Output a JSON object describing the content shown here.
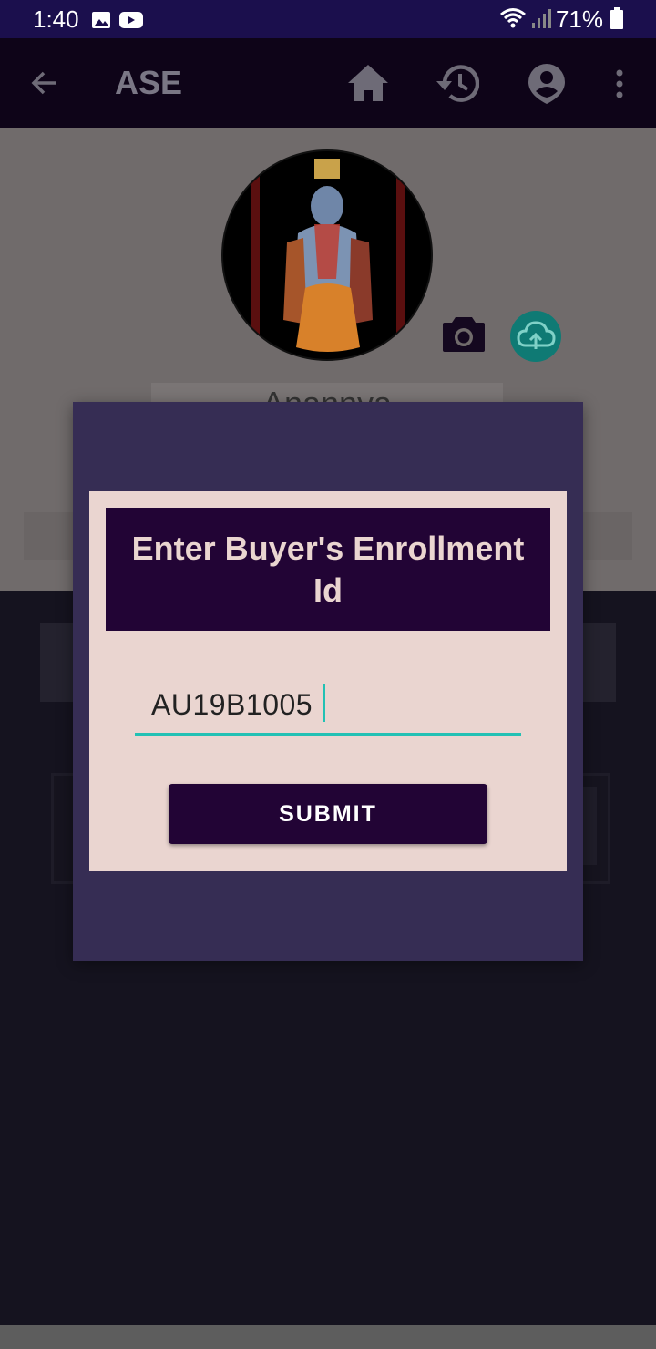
{
  "status_bar": {
    "time": "1:40",
    "battery": "71%",
    "icons": [
      "gallery-icon",
      "youtube-icon",
      "wifi-icon",
      "signal-icon",
      "battery-icon"
    ]
  },
  "app_bar": {
    "title": "ASE",
    "icons": [
      "back-arrow-icon",
      "home-icon",
      "history-icon",
      "account-icon",
      "more-vert-icon"
    ]
  },
  "profile": {
    "name": "Anannya"
  },
  "dialog": {
    "title": "Enter Buyer's Enrollment Id",
    "input_value": "AU19B1005",
    "submit_label": "SUBMIT"
  },
  "colors": {
    "status_bar": "#1b0f4d",
    "app_bar": "#0e0418",
    "dialog_bg": "#362d54",
    "panel_bg": "#ead5d0",
    "accent_dark": "#220435",
    "underline": "#22c1b4"
  }
}
